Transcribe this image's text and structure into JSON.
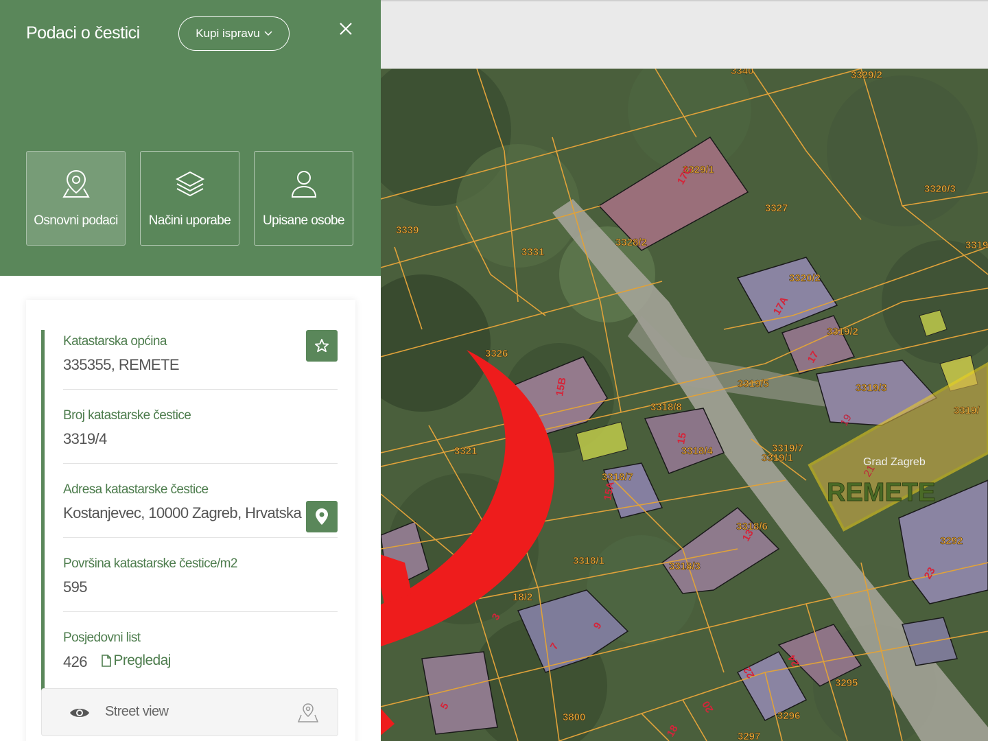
{
  "header": {
    "title": "Podaci o čestici",
    "buy_button": "Kupi ispravu"
  },
  "tabs": [
    {
      "label": "Osnovni podaci",
      "icon": "map-pin-icon"
    },
    {
      "label": "Načini uporabe",
      "icon": "layers-icon"
    },
    {
      "label": "Upisane osobe",
      "icon": "user-icon"
    }
  ],
  "fields": {
    "municipality": {
      "label": "Katastarska općina",
      "value": "335355, REMETE"
    },
    "parcel_number": {
      "label": "Broj katastarske čestice",
      "value": "3319/4"
    },
    "address": {
      "label": "Adresa katastarske čestice",
      "value": "Kostanjevec, 10000 Zagreb, Hrvatska"
    },
    "area": {
      "label": "Površina katastarske čestice/m2",
      "value": "595"
    },
    "possession_sheet": {
      "label": "Posjedovni list",
      "value": "426",
      "link": "Pregledaj"
    }
  },
  "street_view": {
    "label": "Street view"
  },
  "map": {
    "parcel_labels": [
      "3340",
      "3329/2",
      "3329/1",
      "17C",
      "3327",
      "3320/3",
      "3339",
      "3331",
      "3328/2",
      "3319",
      "3320/2",
      "17A",
      "3319/2",
      "17",
      "3326",
      "15B",
      "3319/5",
      "3319/3",
      "3318/8",
      "15",
      "3318/4",
      "3319/7",
      "3319/1",
      "3319/",
      "3321",
      "3318/7",
      "15A",
      "3318/6",
      "13",
      "3318/3",
      "3318/1",
      "3292",
      "23",
      "18/2",
      "9",
      "7",
      "3",
      "24",
      "3295",
      "22",
      "20",
      "3296",
      "5",
      "3800",
      "18",
      "3297"
    ],
    "area_labels": {
      "city": "Grad Zagreb",
      "district": "REMETE",
      "house_number": "21",
      "house_number_2": "19"
    },
    "colors": {
      "parcel_line": "#e0a23a",
      "highlight": "#f2d21c",
      "arrow": "#ee1c1c",
      "panel_green": "#5a875a"
    }
  }
}
